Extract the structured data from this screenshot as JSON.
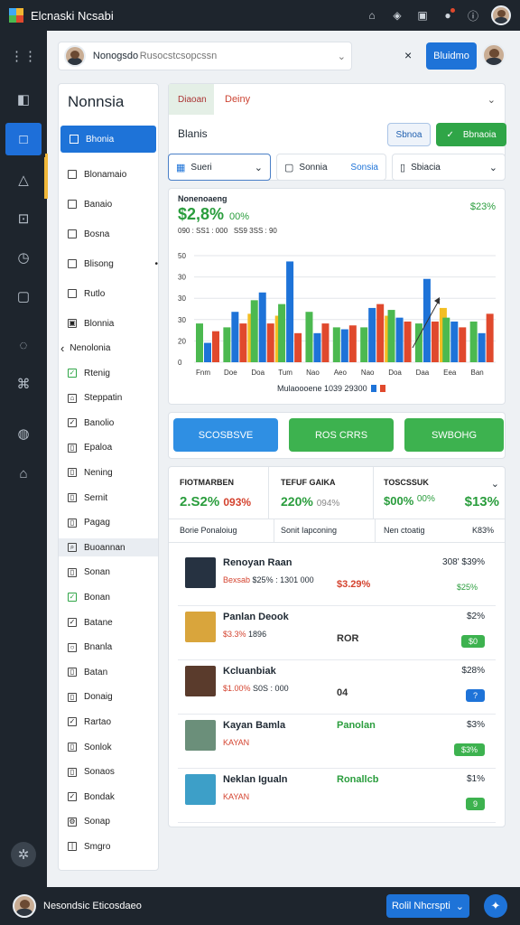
{
  "app": {
    "title": "Elcnaski Ncsabi",
    "user_avatar": "avatar"
  },
  "header": {
    "user_name": "Nonogsdo",
    "search_placeholder": "Rusocstcsopcssn",
    "close": "×",
    "primary_button": "Bluidmo"
  },
  "sidebar": {
    "title": "Nonnsia",
    "selected": "Bhonia",
    "items": [
      {
        "label": "Blonamaio",
        "icon": "checkbox-icon"
      },
      {
        "label": "Banaio",
        "icon": "checkbox-icon"
      },
      {
        "label": "Bosna",
        "icon": "checkbox-icon"
      },
      {
        "label": "Blisong",
        "icon": "checkbox-icon"
      },
      {
        "label": "Rutlo",
        "icon": "checkbox-icon"
      },
      {
        "label": "Blonnia",
        "icon": "image-icon"
      }
    ],
    "group_label": "Nenolonia",
    "group_items": [
      {
        "label": "Rtenig",
        "icon": "check-icon"
      },
      {
        "label": "Steppatin",
        "icon": "bag-icon"
      },
      {
        "label": "Banolio",
        "icon": "check-icon"
      },
      {
        "label": "Epaloa",
        "icon": "doc-icon"
      },
      {
        "label": "Nening",
        "icon": "doc-icon"
      },
      {
        "label": "Sernit",
        "icon": "doc-icon"
      },
      {
        "label": "Pagag",
        "icon": "doc-icon"
      },
      {
        "label": "Buoannan",
        "icon": "search-icon"
      },
      {
        "label": "Sonan",
        "icon": "doc-icon"
      },
      {
        "label": "Bonan",
        "icon": "check-icon"
      },
      {
        "label": "Batane",
        "icon": "check-icon"
      },
      {
        "label": "Bnanla",
        "icon": "radio-icon"
      },
      {
        "label": "Batan",
        "icon": "doc-icon"
      },
      {
        "label": "Donaig",
        "icon": "doc-icon"
      },
      {
        "label": "Rartao",
        "icon": "check-icon"
      },
      {
        "label": "Sonlok",
        "icon": "doc-icon"
      },
      {
        "label": "Sonaos",
        "icon": "doc-icon"
      },
      {
        "label": "Bondak",
        "icon": "check-icon"
      },
      {
        "label": "Sonap",
        "icon": "gear-icon"
      },
      {
        "label": "Smgro",
        "icon": "line-icon"
      }
    ]
  },
  "main": {
    "tab_label": "Diaoan",
    "tab_value": "Deiny",
    "section_title": "Blanis",
    "btn_secondary": "Sbnoa",
    "btn_primary": "Bbnaoia",
    "filter1": "Sueri",
    "filter2_label": "Sonnia",
    "filter2_value": "Sonsia",
    "filter3": "Sbiacia"
  },
  "chart_data": {
    "type": "bar",
    "title": "Nonenoaeng",
    "headline_value": "$2,8%",
    "headline_change": "00%",
    "right_value": "$23%",
    "subtitle": "090 : SS1 : 000   SS9 3SS : 90",
    "categories": [
      "Fnm",
      "Doe",
      "Doa",
      "Tum",
      "Nao",
      "Aeo",
      "Nao",
      "Doa",
      "Daa",
      "Eea",
      "Ban"
    ],
    "ylim": [
      0,
      55
    ],
    "yticks": [
      0,
      20,
      30,
      30,
      30,
      50
    ],
    "series": [
      {
        "color": "#4cb950",
        "values": [
          20,
          18,
          32,
          30,
          26,
          18,
          18,
          27,
          20,
          23,
          21
        ]
      },
      {
        "color": "#1e73d8",
        "values": [
          10,
          26,
          36,
          52,
          15,
          17,
          28,
          23,
          43,
          21,
          15
        ]
      },
      {
        "color": "#e0492d",
        "values": [
          16,
          20,
          20,
          15,
          20,
          19,
          30,
          21,
          21,
          18,
          25
        ]
      },
      {
        "color": "#f3be23",
        "values": [
          0,
          25,
          24,
          0,
          0,
          0,
          24,
          0,
          28,
          0,
          0
        ]
      }
    ],
    "legend": "Mulaoooene  1039  29300"
  },
  "actions": [
    "SCOSBSVE",
    "ROS CRRS",
    "SWBOHG"
  ],
  "kpis": [
    {
      "label": "FIOTMARBEN",
      "value": "2.S2%",
      "change": "093%"
    },
    {
      "label": "TEFUF GAIKA",
      "value": "220%",
      "change": "094%"
    },
    {
      "label": "TOSCSSUK",
      "value": "$00%",
      "change": "00%",
      "extra": "$13%"
    }
  ],
  "list_header": [
    "Borie Ponaloiug",
    "Sonit Iapconing",
    "Nen ctoatig",
    "K83%"
  ],
  "list": [
    {
      "title": "Renoyan Raan",
      "sub1": "Bexsab",
      "sub2": "$25% : 1301 000",
      "mid": "$3.29%",
      "right1": "308' $39%",
      "right2": "$25%",
      "thumb": "#263241"
    },
    {
      "title": "Panlan Deook",
      "sub1": "$3.3%",
      "sub2": "1896",
      "mid": "ROR",
      "right1": "$2%",
      "right2": "$0",
      "thumb": "#d9a53c"
    },
    {
      "title": "Kcluanbiak",
      "sub1": "$1.00%",
      "sub2": "S0S : 000",
      "mid": "04",
      "right1": "$28%",
      "right2": "?",
      "thumb": "#5a3b2c"
    },
    {
      "title": "Kayan Bamla",
      "sub1": "KAYAN",
      "sub2": "",
      "mid": "Panolan",
      "right1": "$3%",
      "right2": "$3%",
      "thumb": "#6b8f7a"
    },
    {
      "title": "Neklan Igualn",
      "sub1": "KAYAN",
      "sub2": "",
      "mid": "Ronallcb",
      "right1": "$1%",
      "right2": "9",
      "thumb": "#3d9fc8"
    }
  ],
  "footer": {
    "user": "Nesondsic Eticosdaeo",
    "button": "Rolil Nhcrspti"
  }
}
